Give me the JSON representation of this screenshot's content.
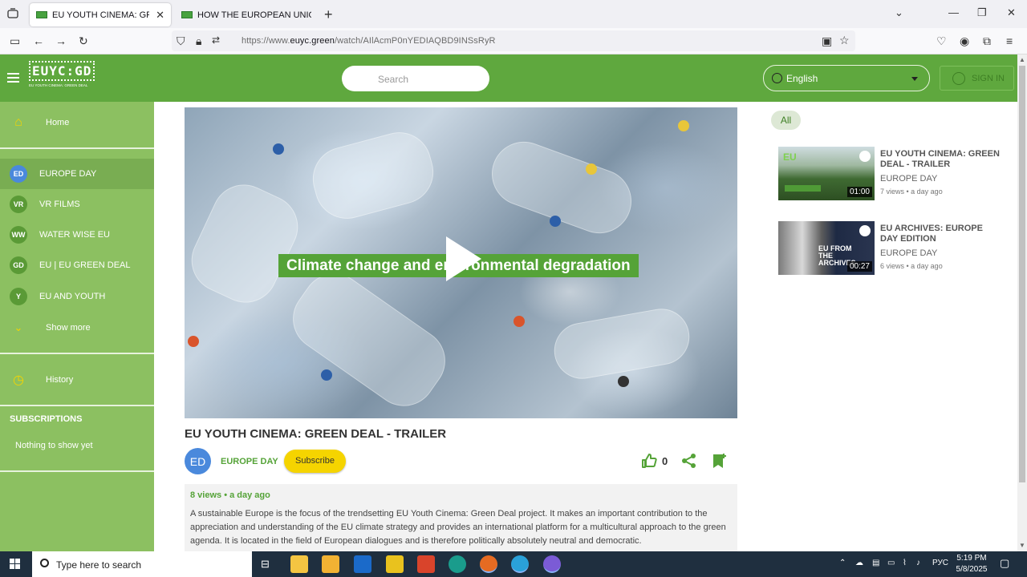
{
  "browser": {
    "tabs": [
      {
        "label": "EU YOUTH CINEMA: GREEN DEA",
        "active": true
      },
      {
        "label": "HOW THE EUROPEAN UNION R",
        "active": false
      }
    ],
    "new_tab": "+",
    "url_prefix": "https://www.",
    "url_domain": "euyc.green",
    "url_path": "/watch/AIlAcmP0nYEDIAQBD9INSsRyR"
  },
  "site": {
    "logo_text": "EUYC:GD",
    "logo_sub": "EU YOUTH CINEMA: GREEN DEAL",
    "search_placeholder": "Search",
    "language": "English",
    "signin": "SIGN IN"
  },
  "sidebar": {
    "home": "Home",
    "channels": [
      {
        "badge": "ED",
        "label": "EUROPE DAY",
        "color": "#4a89dc",
        "active": true
      },
      {
        "badge": "VR",
        "label": "VR FILMS",
        "color": "#5a9a36",
        "active": false
      },
      {
        "badge": "WW",
        "label": "WATER WISE EU",
        "color": "#5a9a36",
        "active": false
      },
      {
        "badge": "GD",
        "label": "EU | EU GREEN DEAL",
        "color": "#5a9a36",
        "active": false
      },
      {
        "badge": "Y",
        "label": "EU AND YOUTH",
        "color": "#5a9a36",
        "active": false
      }
    ],
    "show_more": "Show more",
    "history": "History",
    "subscriptions_title": "SUBSCRIPTIONS",
    "subscriptions_empty": "Nothing to show yet"
  },
  "video": {
    "caption": "Climate change and environmental degradation",
    "title": "EU YOUTH CINEMA: GREEN DEAL - TRAILER",
    "channel_badge": "ED",
    "channel": "EUROPE DAY",
    "subscribe": "Subscribe",
    "likes": "0",
    "meta": "8 views • a day ago",
    "description": "A sustainable Europe is the focus of the trendsetting EU Youth Cinema: Green Deal project. It makes an important contribution to the appreciation and understanding of the EU climate strategy and provides an international platform for a multicultural approach to the green agenda. It is located in the field of European dialogues and is therefore politically absolutely neutral and democratic."
  },
  "recommendations": {
    "filter_all": "All",
    "items": [
      {
        "title": "EU YOUTH CINEMA: GREEN DEAL - TRAILER",
        "channel": "EUROPE DAY",
        "meta": "7 views • a day ago",
        "duration": "01:00",
        "thumb_text": "EU"
      },
      {
        "title": "EU ARCHIVES: EUROPE DAY EDITION",
        "channel": "EUROPE DAY",
        "meta": "6 views • a day ago",
        "duration": "00:27",
        "thumb_text": "EU FROM THE ARCHIVES"
      }
    ]
  },
  "taskbar": {
    "search_placeholder": "Type here to search",
    "lang": "РУС",
    "time": "5:19 PM",
    "date": "5/8/2025"
  },
  "colors": {
    "brand_green": "#5fa83e",
    "sidebar_green": "#8cc061",
    "accent_yellow": "#f5d400"
  }
}
